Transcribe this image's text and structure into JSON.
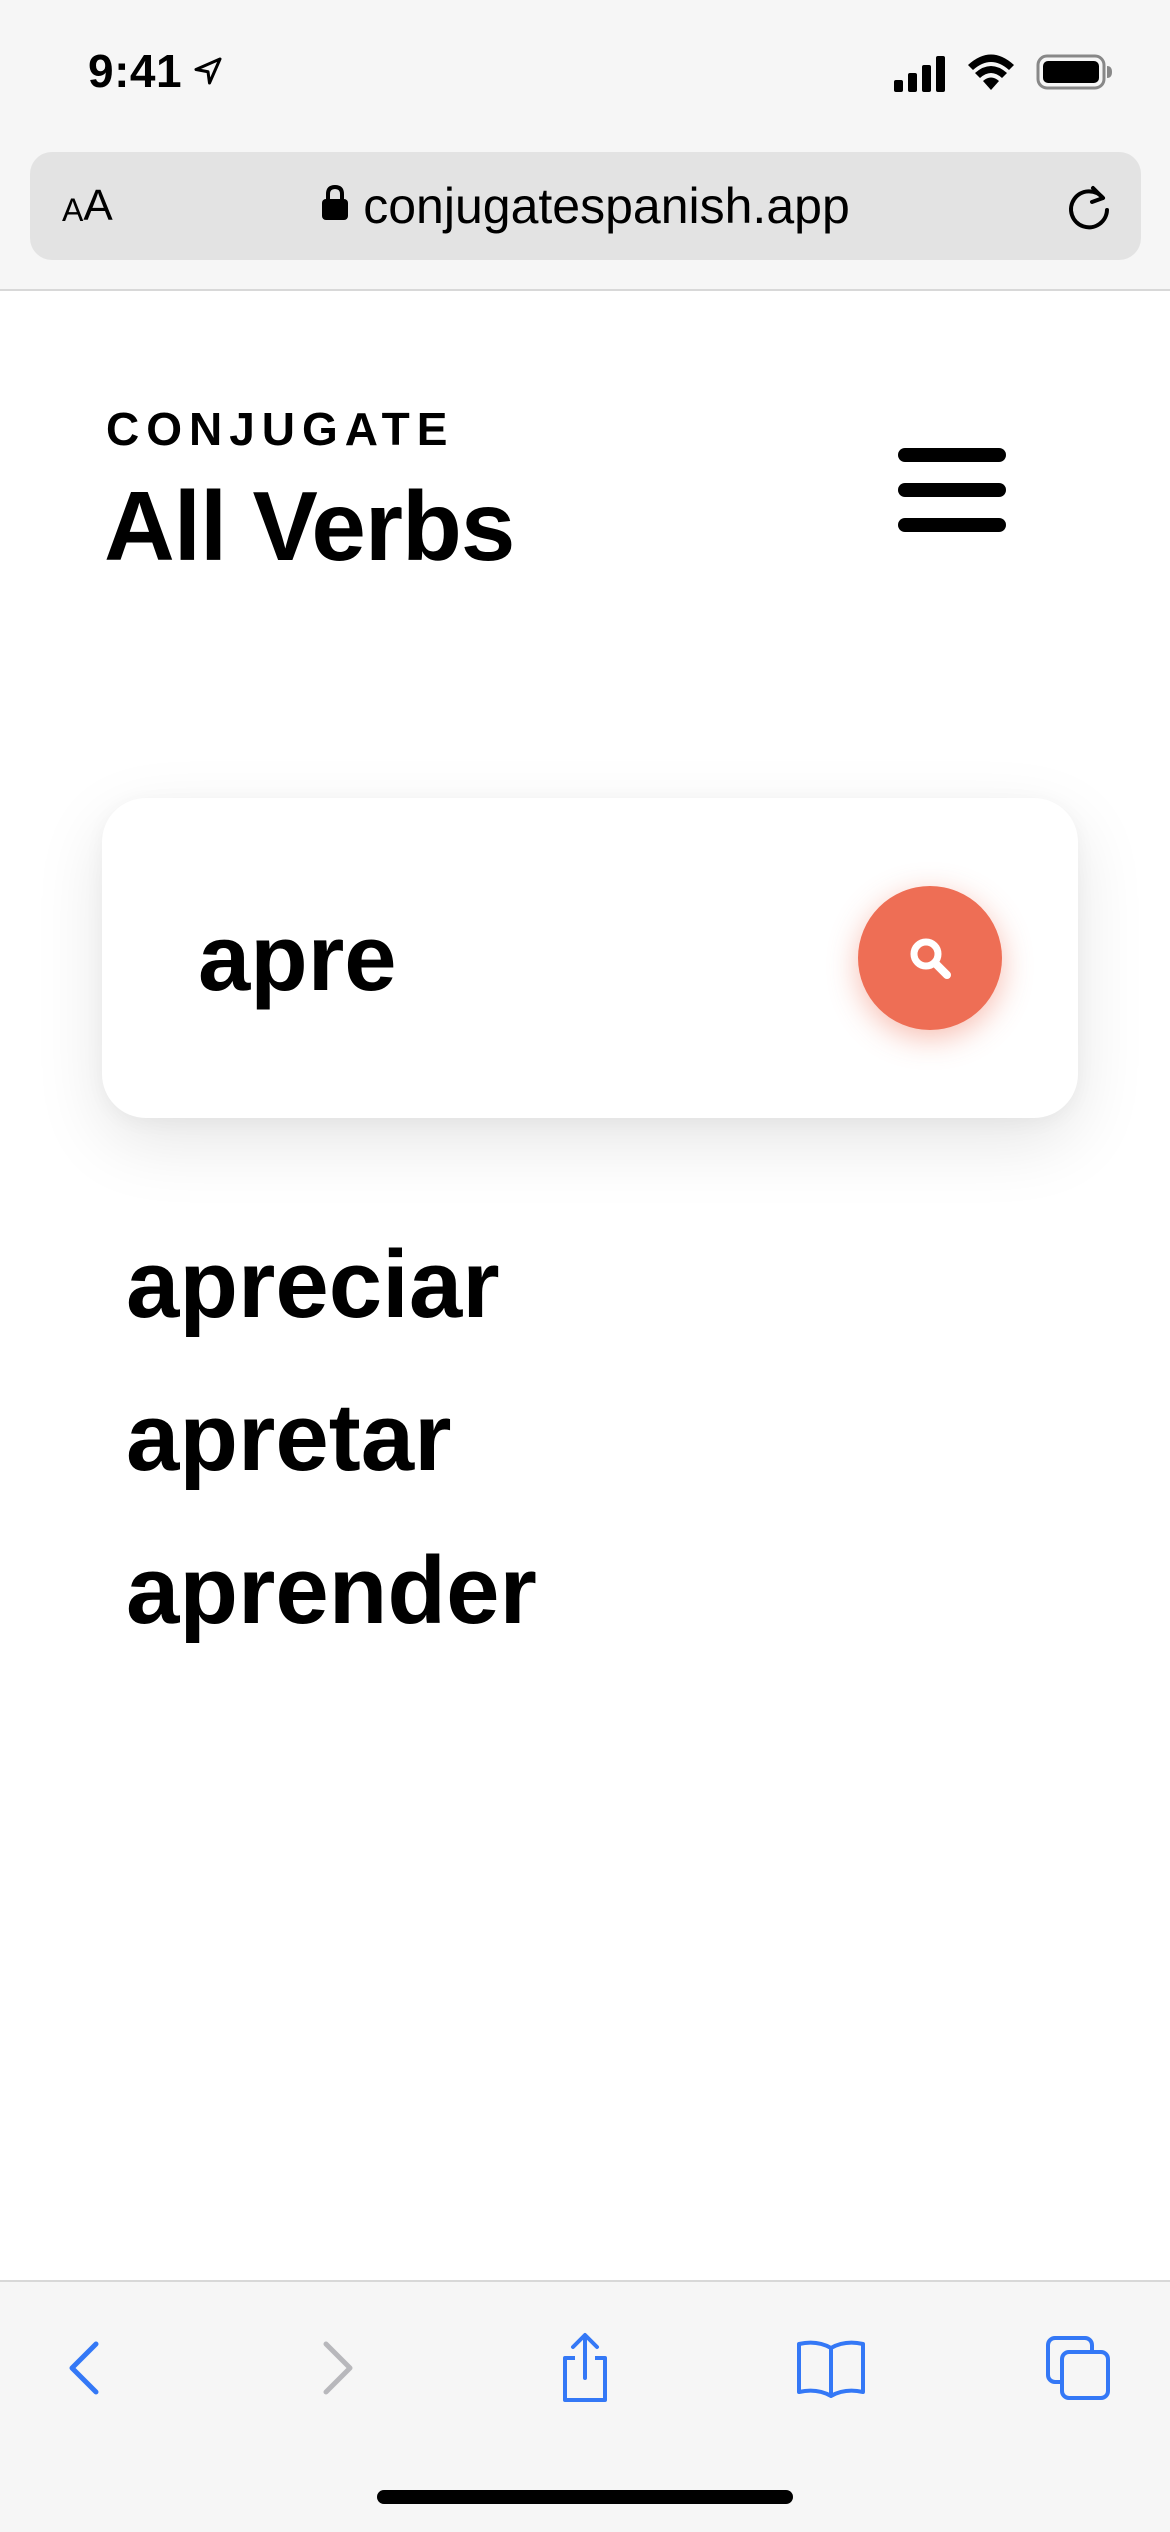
{
  "status_bar": {
    "time": "9:41",
    "icons": [
      "location-arrow-icon",
      "signal-icon",
      "wifi-icon",
      "battery-icon"
    ]
  },
  "browser": {
    "text_size_label_small": "A",
    "text_size_label_large": "A",
    "url": "conjugatespanish.app",
    "accent_color": "#3478f6",
    "toolbar_icons": [
      "back-icon",
      "forward-icon",
      "share-icon",
      "bookmarks-icon",
      "tabs-icon"
    ]
  },
  "header": {
    "eyebrow": "CONJUGATE",
    "title": "All Verbs",
    "menu_icon": "hamburger-menu-icon"
  },
  "search": {
    "value": "apre",
    "button_color": "#ee6e55",
    "button_icon": "search-icon"
  },
  "results": [
    {
      "label": "apreciar"
    },
    {
      "label": "apretar"
    },
    {
      "label": "aprender"
    }
  ]
}
